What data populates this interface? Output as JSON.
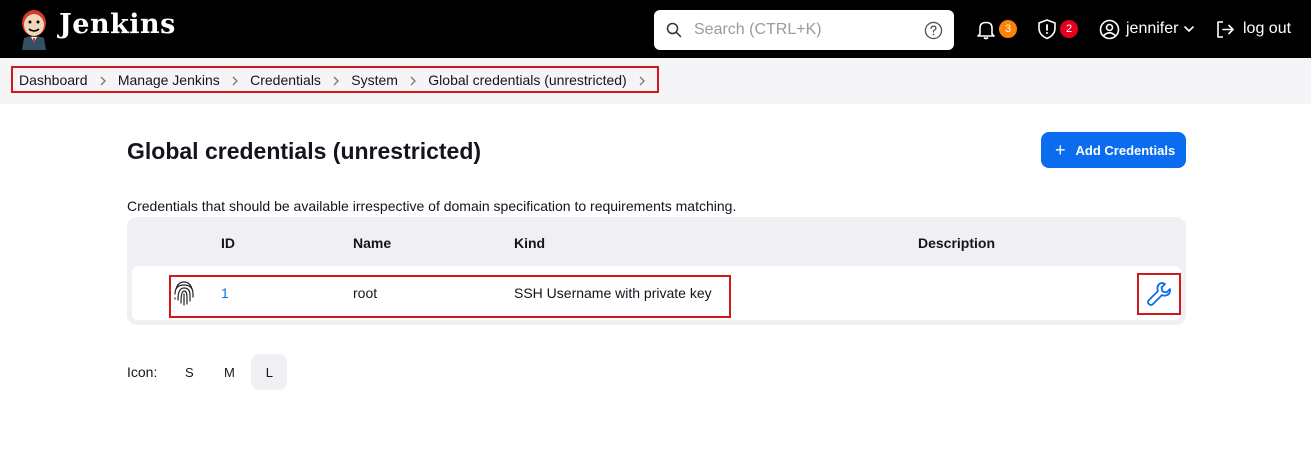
{
  "header": {
    "brand": "Jenkins",
    "search_placeholder": "Search (CTRL+K)",
    "notifications_count": "3",
    "security_count": "2",
    "user_name": "jennifer",
    "logout_label": "log out"
  },
  "breadcrumb": {
    "items": [
      "Dashboard",
      "Manage Jenkins",
      "Credentials",
      "System",
      "Global credentials (unrestricted)"
    ]
  },
  "page": {
    "title": "Global credentials (unrestricted)",
    "add_button_label": "Add Credentials",
    "description": "Credentials that should be available irrespective of domain specification to requirements matching."
  },
  "table": {
    "columns": [
      "ID",
      "Name",
      "Kind",
      "Description"
    ],
    "rows": [
      {
        "icon": "fingerprint-icon",
        "id": "1",
        "name": "root",
        "kind": "SSH Username with private key",
        "description": ""
      }
    ]
  },
  "icon_size": {
    "label": "Icon:",
    "options": [
      "S",
      "M",
      "L"
    ],
    "selected": "L"
  },
  "colors": {
    "accent": "#0b6cf0",
    "header_bg": "#000000",
    "badge_orange": "#fe820a",
    "badge_red": "#e6001f",
    "highlight": "#d21919"
  }
}
